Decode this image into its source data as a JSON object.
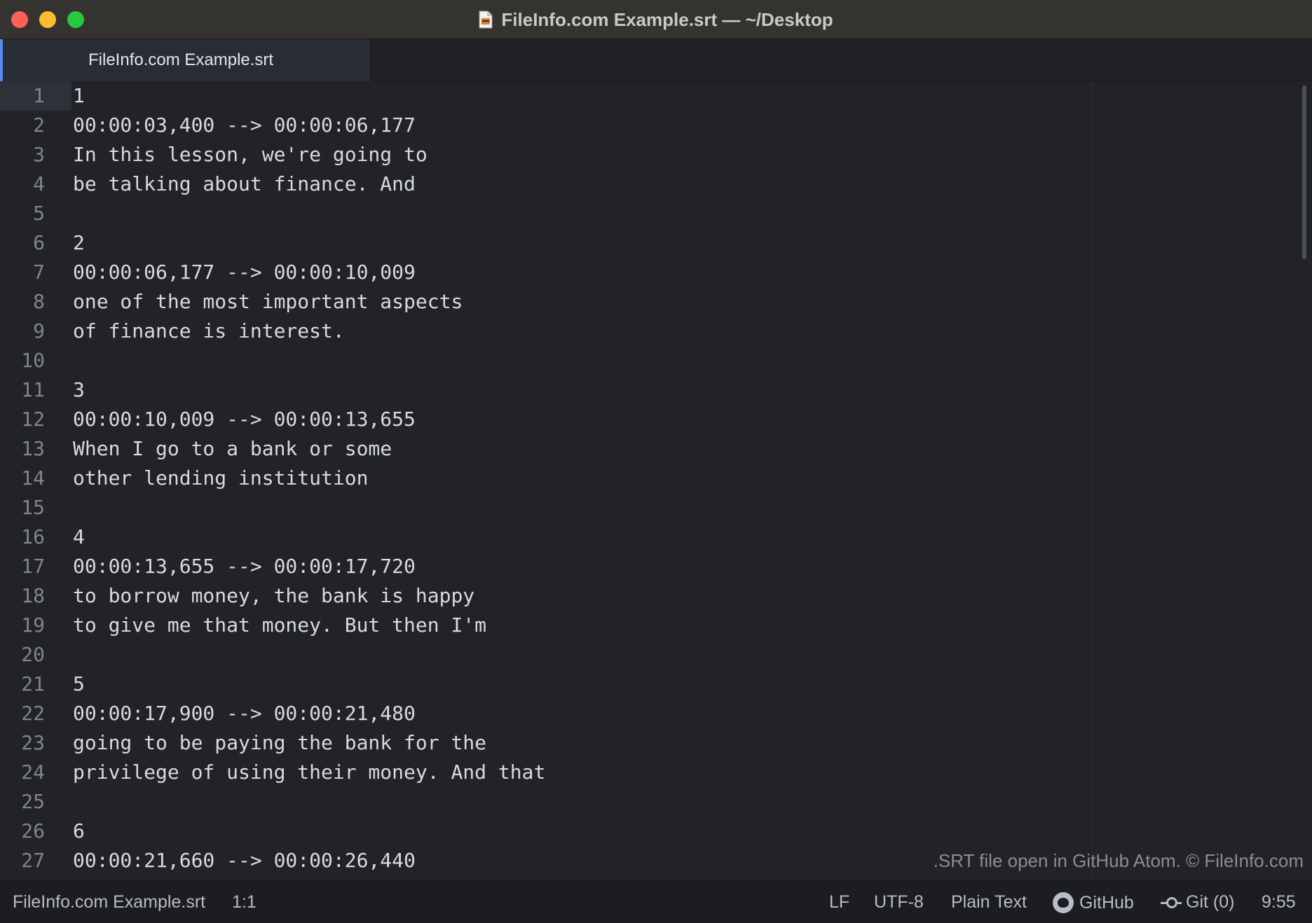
{
  "window": {
    "title": "FileInfo.com Example.srt — ~/Desktop"
  },
  "tabs": [
    {
      "label": "FileInfo.com Example.srt"
    }
  ],
  "editor": {
    "lines": [
      "1",
      "00:00:03,400 --> 00:00:06,177",
      "In this lesson, we're going to",
      "be talking about finance. And",
      "",
      "2",
      "00:00:06,177 --> 00:00:10,009",
      "one of the most important aspects",
      "of finance is interest.",
      "",
      "3",
      "00:00:10,009 --> 00:00:13,655",
      "When I go to a bank or some",
      "other lending institution",
      "",
      "4",
      "00:00:13,655 --> 00:00:17,720",
      "to borrow money, the bank is happy",
      "to give me that money. But then I'm",
      "",
      "5",
      "00:00:17,900 --> 00:00:21,480",
      "going to be paying the bank for the",
      "privilege of using their money. And that",
      "",
      "6",
      "00:00:21,660 --> 00:00:26,440"
    ],
    "line_numbers": [
      "1",
      "2",
      "3",
      "4",
      "5",
      "6",
      "7",
      "8",
      "9",
      "10",
      "11",
      "12",
      "13",
      "14",
      "15",
      "16",
      "17",
      "18",
      "19",
      "20",
      "21",
      "22",
      "23",
      "24",
      "25",
      "26",
      "27"
    ]
  },
  "watermark": ".SRT file open in GitHub Atom. © FileInfo.com",
  "statusbar": {
    "file": "FileInfo.com Example.srt",
    "cursor": "1:1",
    "line_ending": "LF",
    "encoding": "UTF-8",
    "grammar": "Plain Text",
    "github": "GitHub",
    "git": "Git (0)",
    "time": "9:55"
  }
}
